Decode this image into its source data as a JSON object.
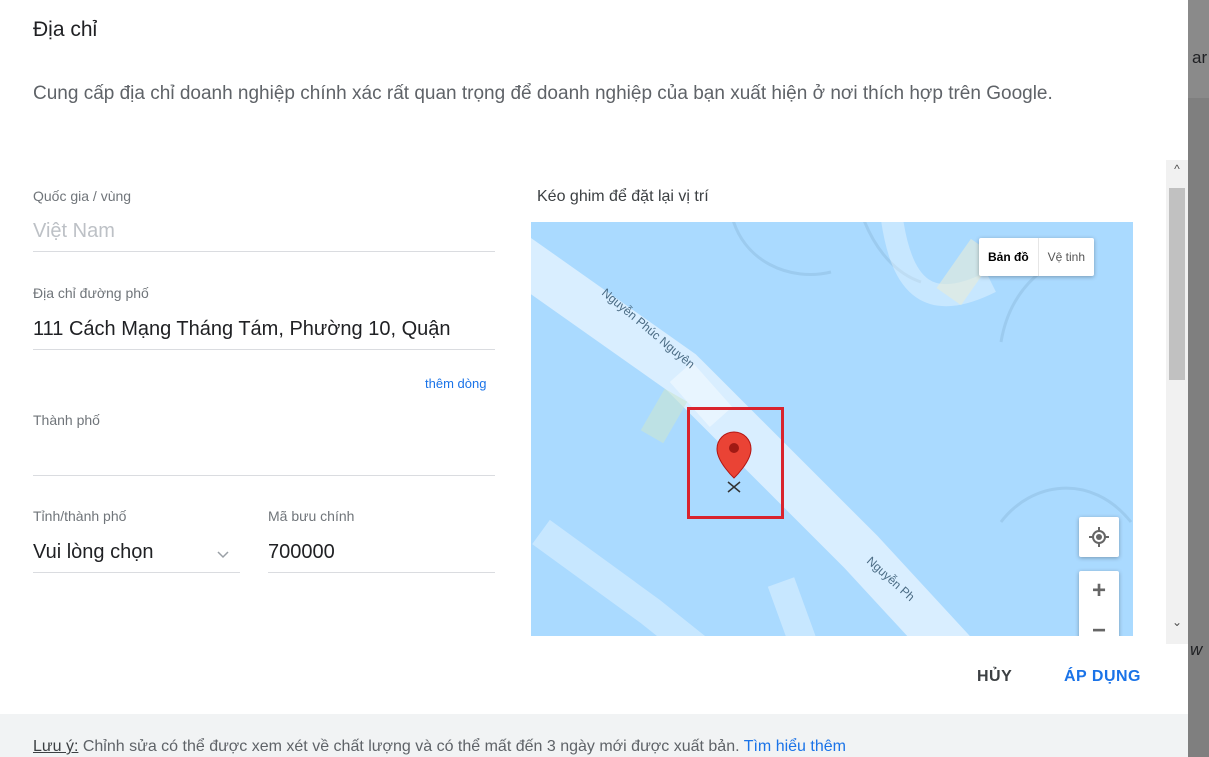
{
  "header": {
    "title": "Địa chỉ",
    "description": "Cung cấp địa chỉ doanh nghiệp chính xác rất quan trọng để doanh nghiệp của bạn xuất hiện ở nơi thích hợp trên Google."
  },
  "form": {
    "country": {
      "label": "Quốc gia / vùng",
      "value": "Việt Nam"
    },
    "street": {
      "label": "Địa chỉ đường phố",
      "value": "111 Cách Mạng Tháng Tám, Phường 10, Quận"
    },
    "add_line": "thêm dòng",
    "city": {
      "label": "Thành phố",
      "value": ""
    },
    "province": {
      "label": "Tỉnh/thành phố",
      "value": "Vui lòng chọn",
      "icon": "chevron-down-icon"
    },
    "postal": {
      "label": "Mã bưu chính",
      "value": "700000"
    }
  },
  "map": {
    "label": "Kéo ghim để đặt lại vị trí",
    "type_map": "Bản đồ",
    "type_satellite": "Vệ tinh",
    "street_label_1": "Nguyễn Phúc Nguyên",
    "street_label_2": "Nguyễn Ph",
    "zoom_in": "+",
    "zoom_out": "−",
    "water_color": "#aadaff",
    "pin_color": "#ea4335",
    "highlight_color": "#d9232d"
  },
  "actions": {
    "cancel": "HỦY",
    "apply": "ÁP DỤNG",
    "apply_color": "#1a73e8"
  },
  "note": {
    "prefix": "Lưu ý:",
    "text": " Chỉnh sửa có thể được xem xét về chất lượng và có thể mất đến 3 ngày mới được xuất bản. ",
    "link": "Tìm hiểu thêm"
  },
  "background": {
    "text_top": "ar",
    "text_bottom": "w"
  }
}
